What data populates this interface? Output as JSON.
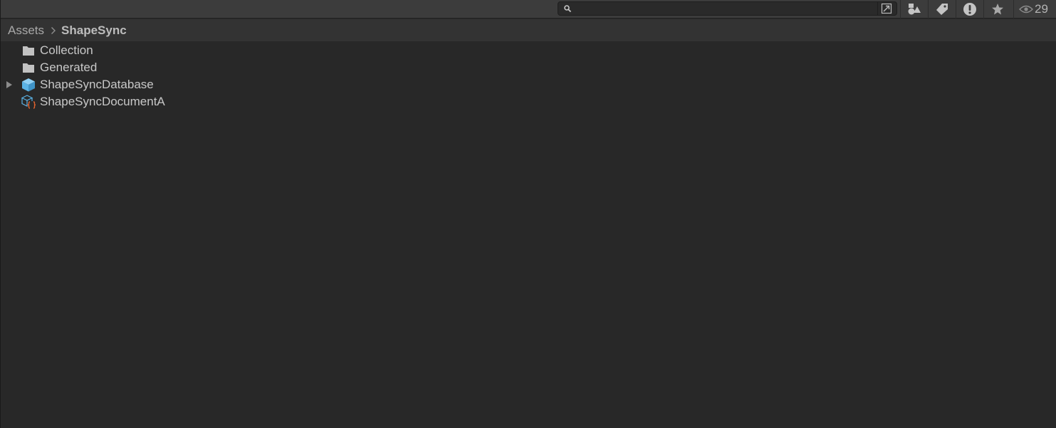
{
  "search": {
    "value": "",
    "placeholder": ""
  },
  "toolbar": {
    "buttons": [
      {
        "icon": "search-by-type-icon"
      },
      {
        "icon": "label-tag-icon"
      },
      {
        "icon": "warning-filter-icon"
      },
      {
        "icon": "favorites-star-icon"
      }
    ],
    "hidden_count": "29"
  },
  "breadcrumb": {
    "items": [
      "Assets",
      "ShapeSync"
    ]
  },
  "assets": [
    {
      "label": "Collection",
      "icon": "folder-icon",
      "expandable": false
    },
    {
      "label": "Generated",
      "icon": "folder-icon",
      "expandable": false
    },
    {
      "label": "ShapeSyncDatabase",
      "icon": "prefab-cube-icon",
      "expandable": true
    },
    {
      "label": "ShapeSyncDocumentA",
      "icon": "scriptable-object-icon",
      "expandable": false
    }
  ],
  "colors": {
    "background": "#282828",
    "toolbar": "#3c3c3c",
    "breadcrumb_bar": "#333333",
    "prefab_blue": "#5bb3e6",
    "script_orange": "#e0622e"
  }
}
